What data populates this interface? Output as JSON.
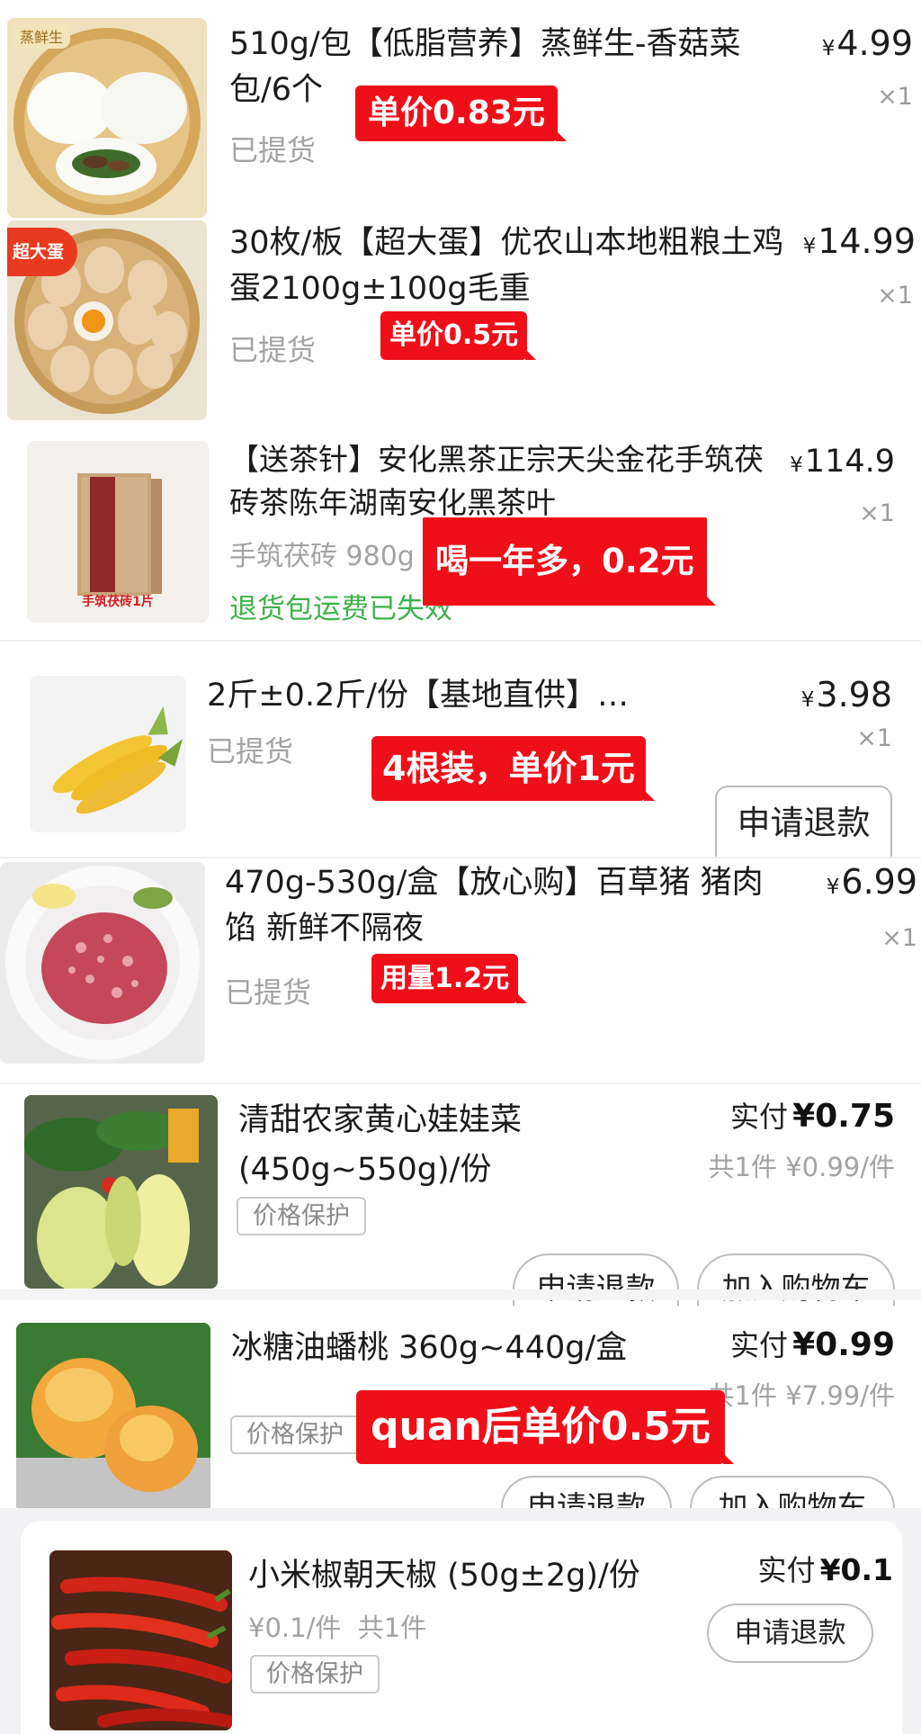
{
  "orders": [
    {
      "title": "510g/包【低脂营养】蒸鲜生-香菇菜包/6个",
      "status": "已提货",
      "price": "4.99",
      "qty": "×1",
      "promo": "单价0.83元",
      "logo_text": "蒸鲜生",
      "image": "steamed-bun-image"
    },
    {
      "title": "30枚/板【超大蛋】优农山本地粗粮土鸡蛋2100g±100g毛重",
      "status": "已提货",
      "price": "14.99",
      "qty": "×1",
      "promo": "单价0.5元",
      "badge": "超大蛋",
      "image": "eggs-image"
    },
    {
      "title": "【送茶针】安化黑茶正宗天尖金花手筑茯砖茶陈年湖南安化黑茶叶",
      "spec": "手筑茯砖 980g",
      "note": "退货包运费已失效",
      "price": "114.9",
      "qty": "×1",
      "promo": "喝一年多，0.2元",
      "caption": "手筑茯砖1片",
      "image": "tea-brick-image"
    },
    {
      "title": "2斤±0.2斤/份【基地直供】…",
      "status": "已提货",
      "price": "3.98",
      "qty": "×1",
      "promo": "4根装，单价1元",
      "refund": "申请退款",
      "image": "corn-image"
    },
    {
      "title": "470g-530g/盒【放心购】百草猪 猪肉馅 新鲜不隔夜",
      "status": "已提货",
      "price": "6.99",
      "qty": "×1",
      "promo": "用量1.2元",
      "image": "minced-pork-image"
    },
    {
      "title": "清甜农家黄心娃娃菜 (450g~550g)/份",
      "paid_label": "实付",
      "paid_value": "¥0.75",
      "sub": "共1件 ¥0.99/件",
      "protect": "价格保护",
      "refund": "申请退款",
      "cart": "加入购物车",
      "image": "baby-cabbage-image"
    },
    {
      "title": "冰糖油蟠桃 360g~440g/盒",
      "paid_label": "实付",
      "paid_value": "¥0.99",
      "sub": "共1件 ¥7.99/件",
      "protect": "价格保护",
      "refund": "申请退款",
      "cart": "加入购物车",
      "promo": "quan后单价0.5元",
      "image": "flat-peach-image"
    },
    {
      "title": "小米椒朝天椒 (50g±2g)/份",
      "paid_label": "实付",
      "paid_value": "¥0.1",
      "sub": "¥0.1/件  共1件",
      "protect": "价格保护",
      "refund": "申请退款",
      "image": "chili-pepper-image"
    }
  ],
  "currency_symbol": "¥",
  "colors": {
    "promo_red": "#ef0f19",
    "status_grey": "#a3a3a3",
    "note_green": "#3db24a"
  }
}
